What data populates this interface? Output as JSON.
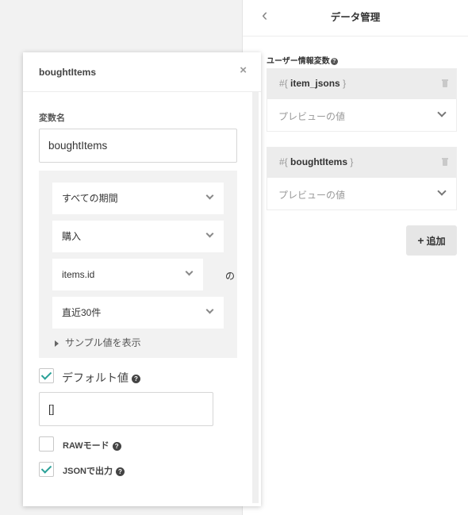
{
  "right_panel": {
    "title": "データ管理",
    "section_label": "ユーザー情報変数",
    "variables": [
      {
        "prefix": "#{",
        "name": "item_jsons",
        "suffix": "}",
        "preview": "プレビューの値"
      },
      {
        "prefix": "#{",
        "name": "boughtItems",
        "suffix": "}",
        "preview": "プレビューの値"
      }
    ],
    "add_button": "追加",
    "add_symbol": "+"
  },
  "modal": {
    "title": "boughtItems",
    "close_symbol": "×",
    "var_name_label": "変数名",
    "var_name_value": "boughtItems",
    "period_select": "すべての期間",
    "event_select": "購入",
    "field_select": "items.id",
    "no_label": "の",
    "limit_select": "直近30件",
    "sample_toggle": "サンプル値を表示",
    "default_label": "デフォルト値",
    "default_checked": true,
    "default_value": "[]",
    "raw_label": "RAWモード",
    "raw_checked": false,
    "json_label": "JSONで出力",
    "json_checked": true,
    "help_symbol": "?"
  },
  "colors": {
    "check": "#2aa198"
  }
}
